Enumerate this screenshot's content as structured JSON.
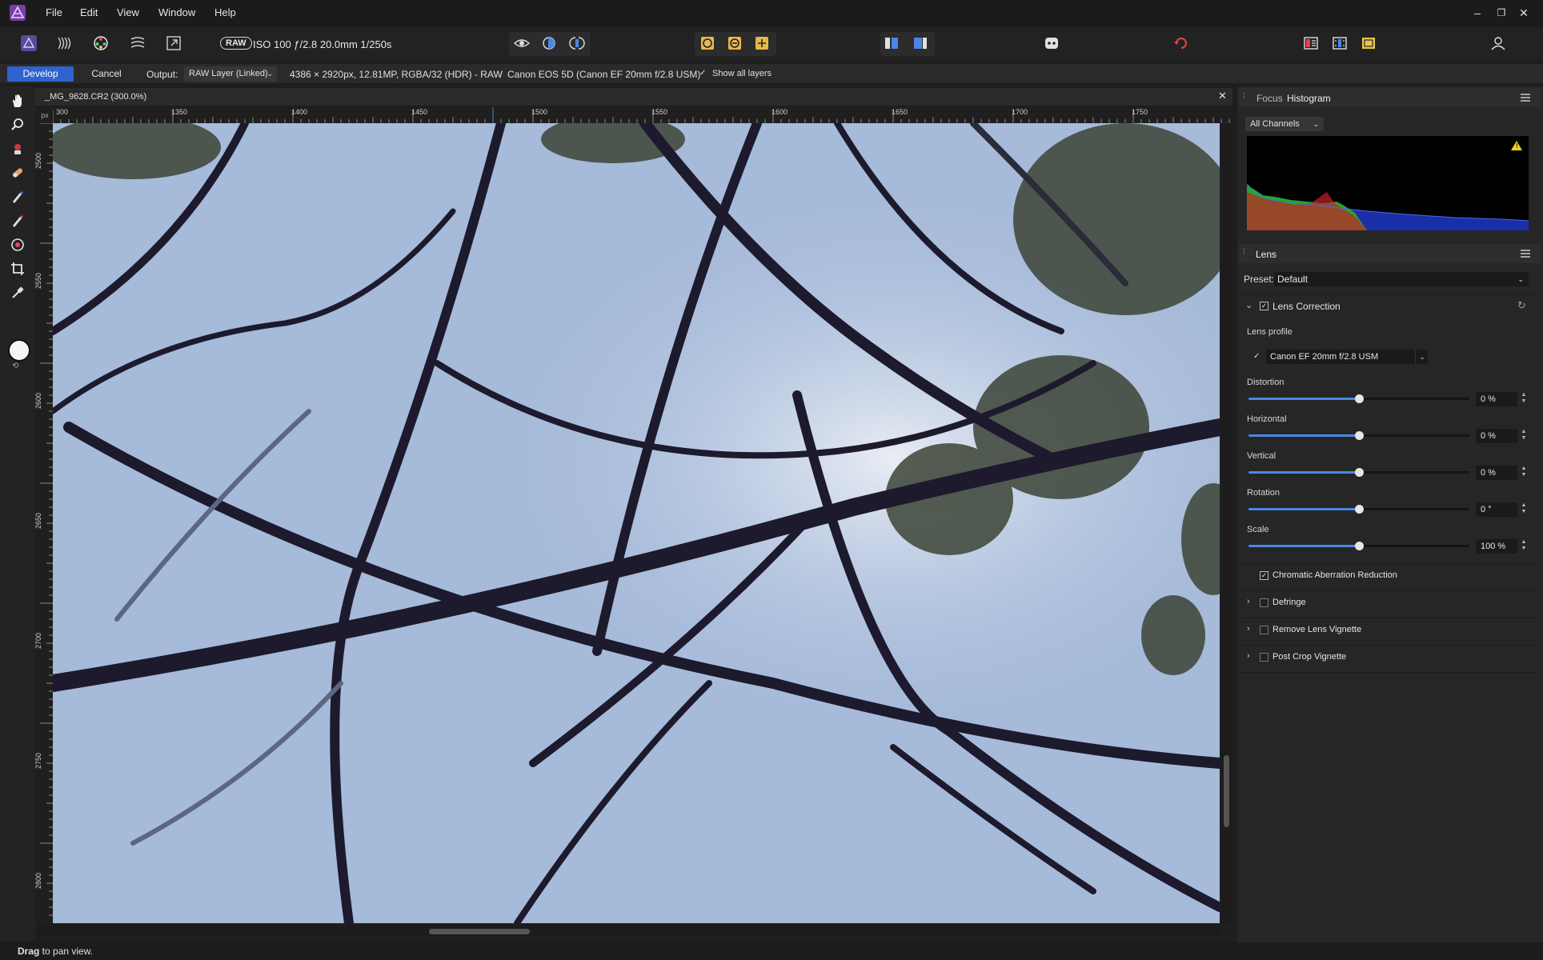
{
  "menu": {
    "items": [
      "File",
      "Edit",
      "View",
      "Window",
      "Help"
    ]
  },
  "window_controls": {
    "minimize": "–",
    "restore": "❐",
    "close": "✕"
  },
  "toolbar": {
    "raw_badge": "RAW",
    "exif": "ISO 100 ƒ/2.8 20.0mm 1/250s",
    "personas": [
      "develop-persona-icon",
      "tone-map-persona-icon",
      "photo-persona-icon",
      "liquify-persona-icon",
      "export-persona-icon"
    ]
  },
  "context": {
    "develop_label": "Develop",
    "cancel_label": "Cancel",
    "output_label": "Output:",
    "output_value": "RAW Layer (Linked)",
    "image_info": "4386 × 2920px, 12.81MP, RGBA/32 (HDR) - RAW",
    "camera_info": "Canon EOS 5D (Canon EF 20mm f/2.8 USM)",
    "show_all_layers": "Show all layers"
  },
  "document": {
    "title": "_MG_9628.CR2 (300.0%)",
    "ruler_unit": "px",
    "ruler_top_ticks": [
      "300",
      "1350",
      "1400",
      "1450",
      "1500",
      "1550",
      "1600",
      "1650",
      "1700",
      "1750"
    ],
    "ruler_left_ticks": [
      "2500",
      "2550",
      "2600",
      "2650",
      "2700",
      "2750",
      "2800"
    ]
  },
  "status": {
    "bold": "Drag",
    "rest": " to pan view."
  },
  "histogram_panel": {
    "tabs": [
      "Focus",
      "Histogram"
    ],
    "active_tab": "Histogram",
    "channels": "All Channels",
    "warning_icon": "clipping-warning-icon"
  },
  "lens_panel": {
    "title": "Lens",
    "preset_label": "Preset:",
    "preset_value": "Default",
    "lens_correction": {
      "label": "Lens Correction",
      "enabled": true,
      "profile_label": "Lens profile",
      "profile_value": "Canon EF 20mm f/2.8 USM",
      "profile_enabled": true
    },
    "sliders": [
      {
        "label": "Distortion",
        "value": "0 %",
        "level": 0.5
      },
      {
        "label": "Horizontal",
        "value": "0 %",
        "level": 0.5
      },
      {
        "label": "Vertical",
        "value": "0 %",
        "level": 0.5
      },
      {
        "label": "Rotation",
        "value": "0 °",
        "level": 0.5
      },
      {
        "label": "Scale",
        "value": "100 %",
        "level": 0.5
      }
    ],
    "chromatic": {
      "label": "Chromatic Aberration Reduction",
      "enabled": true
    },
    "sections": [
      {
        "label": "Defringe",
        "enabled": false
      },
      {
        "label": "Remove Lens Vignette",
        "enabled": false
      },
      {
        "label": "Post Crop Vignette",
        "enabled": false
      }
    ]
  },
  "colors": {
    "accent": "#2f63cf",
    "slider": "#4a87e8",
    "sky": "#a7bbdb",
    "branches": "#1d1a2e"
  }
}
